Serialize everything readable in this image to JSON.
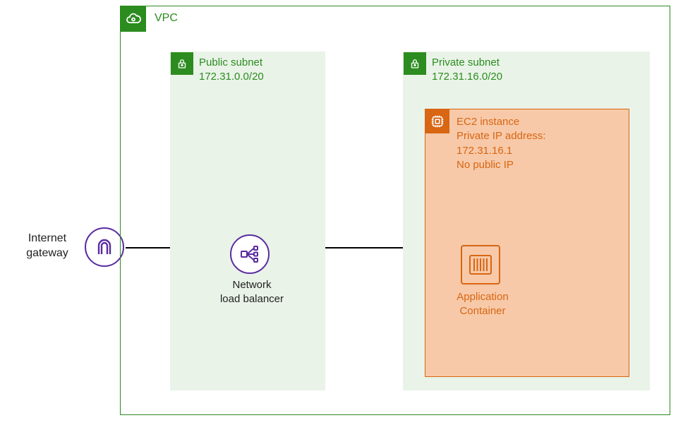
{
  "vpc": {
    "label": "VPC"
  },
  "gateway": {
    "line1": "Internet",
    "line2": "gateway"
  },
  "public_subnet": {
    "title": "Public subnet",
    "cidr": "172.31.0.0/20",
    "nlb": {
      "line1": "Network",
      "line2": "load balancer"
    }
  },
  "private_subnet": {
    "title": "Private subnet",
    "cidr": "172.31.16.0/20",
    "ec2": {
      "line1": "EC2 instance",
      "line2": "Private IP address:",
      "line3": "172.31.16.1",
      "line4": "No public IP"
    },
    "container": {
      "line1": "Application",
      "line2": "Container"
    }
  },
  "colors": {
    "vpc_green": "#2c8c1f",
    "subnet_fill": "#e9f3e8",
    "ec2_orange": "#d86613",
    "ec2_fill": "#f7c9a8",
    "purple": "#5a2ca0"
  }
}
